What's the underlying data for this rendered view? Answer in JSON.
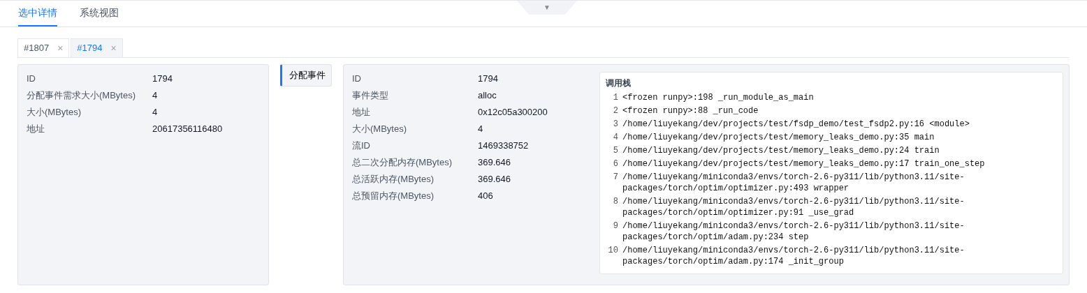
{
  "main_tabs": [
    {
      "label": "选中详情",
      "selected": true
    },
    {
      "label": "系统视图",
      "selected": false
    }
  ],
  "collapse_toggle": {
    "glyph": "▼"
  },
  "detail_tabs": [
    {
      "label": "#1807",
      "selected": false,
      "close": "×"
    },
    {
      "label": "#1794",
      "selected": true,
      "close": "×"
    }
  ],
  "block_info": [
    {
      "label": "ID",
      "value": "1794"
    },
    {
      "label": "分配事件需求大小(MBytes)",
      "value": "4"
    },
    {
      "label": "大小(MBytes)",
      "value": "4"
    },
    {
      "label": "地址",
      "value": "20617356116480"
    }
  ],
  "event_list": [
    {
      "label": "分配事件",
      "selected": true
    }
  ],
  "event_info": [
    {
      "label": "ID",
      "value": "1794"
    },
    {
      "label": "事件类型",
      "value": "alloc"
    },
    {
      "label": "地址",
      "value": "0x12c05a300200"
    },
    {
      "label": "大小(MBytes)",
      "value": "4"
    },
    {
      "label": "流ID",
      "value": "1469338752"
    },
    {
      "label": "总二次分配内存(MBytes)",
      "value": "369.646"
    },
    {
      "label": "总活跃内存(MBytes)",
      "value": "369.646"
    },
    {
      "label": "总预留内存(MBytes)",
      "value": "406"
    }
  ],
  "call_stack": {
    "title": "调用栈",
    "frames": [
      {
        "index": "1",
        "text": "<frozen runpy>:198 _run_module_as_main"
      },
      {
        "index": "2",
        "text": "<frozen runpy>:88 _run_code"
      },
      {
        "index": "3",
        "text": "/home/liuyekang/dev/projects/test/fsdp_demo/test_fsdp2.py:16 <module>"
      },
      {
        "index": "4",
        "text": "/home/liuyekang/dev/projects/test/memory_leaks_demo.py:35 main"
      },
      {
        "index": "5",
        "text": "/home/liuyekang/dev/projects/test/memory_leaks_demo.py:24 train"
      },
      {
        "index": "6",
        "text": "/home/liuyekang/dev/projects/test/memory_leaks_demo.py:17 train_one_step"
      },
      {
        "index": "7",
        "text": "/home/liuyekang/miniconda3/envs/torch-2.6-py311/lib/python3.11/site-packages/torch/optim/optimizer.py:493 wrapper"
      },
      {
        "index": "8",
        "text": "/home/liuyekang/miniconda3/envs/torch-2.6-py311/lib/python3.11/site-packages/torch/optim/optimizer.py:91 _use_grad"
      },
      {
        "index": "9",
        "text": "/home/liuyekang/miniconda3/envs/torch-2.6-py311/lib/python3.11/site-packages/torch/optim/adam.py:234 step"
      },
      {
        "index": "10",
        "text": "/home/liuyekang/miniconda3/envs/torch-2.6-py311/lib/python3.11/site-packages/torch/optim/adam.py:174 _init_group"
      }
    ]
  }
}
